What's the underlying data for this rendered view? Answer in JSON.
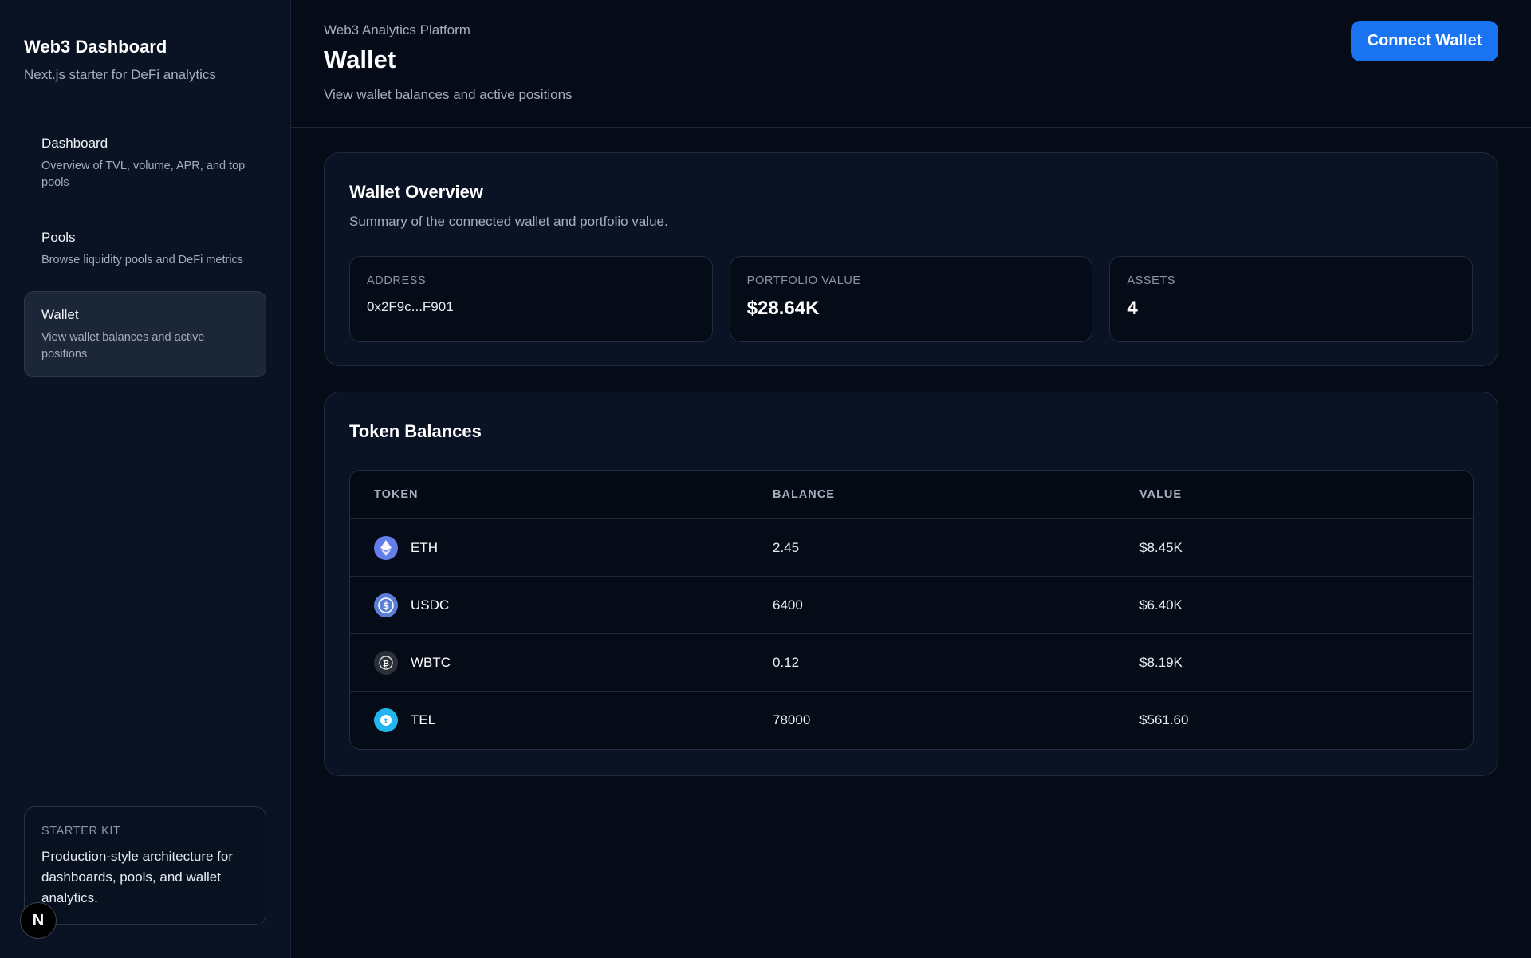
{
  "sidebar": {
    "brand_title": "Web3 Dashboard",
    "brand_subtitle": "Next.js starter for DeFi analytics",
    "items": [
      {
        "label": "Dashboard",
        "description": "Overview of TVL, volume, APR, and top pools",
        "active": false
      },
      {
        "label": "Pools",
        "description": "Browse liquidity pools and DeFi metrics",
        "active": false
      },
      {
        "label": "Wallet",
        "description": "View wallet balances and active positions",
        "active": true
      }
    ],
    "starter": {
      "tag": "STARTER KIT",
      "text": "Production-style architecture for dashboards, pools, and wallet analytics."
    },
    "badge": "N"
  },
  "header": {
    "eyebrow": "Web3 Analytics Platform",
    "title": "Wallet",
    "subtitle": "View wallet balances and active positions",
    "connect_label": "Connect Wallet"
  },
  "overview": {
    "title": "Wallet Overview",
    "subtitle": "Summary of the connected wallet and portfolio value.",
    "stats": [
      {
        "label": "ADDRESS",
        "value": "0x2F9c...F901"
      },
      {
        "label": "PORTFOLIO VALUE",
        "value": "$28.64K"
      },
      {
        "label": "ASSETS",
        "value": "4"
      }
    ]
  },
  "balances": {
    "title": "Token Balances",
    "columns": [
      "TOKEN",
      "BALANCE",
      "VALUE"
    ],
    "rows": [
      {
        "token": "ETH",
        "balance": "2.45",
        "value": "$8.45K",
        "icon": "ethereum-icon",
        "color": "#627eea"
      },
      {
        "token": "USDC",
        "balance": "6400",
        "value": "$6.40K",
        "icon": "usdc-icon",
        "color": "#5b7fd6"
      },
      {
        "token": "WBTC",
        "balance": "0.12",
        "value": "$8.19K",
        "icon": "wbtc-icon",
        "color": "#2b2f38"
      },
      {
        "token": "TEL",
        "balance": "78000",
        "value": "$561.60",
        "icon": "telcoin-icon",
        "color": "#21b6f0"
      }
    ]
  },
  "colors": {
    "accent": "#1a73f0",
    "background": "#050b17",
    "surface": "#0a1324"
  }
}
